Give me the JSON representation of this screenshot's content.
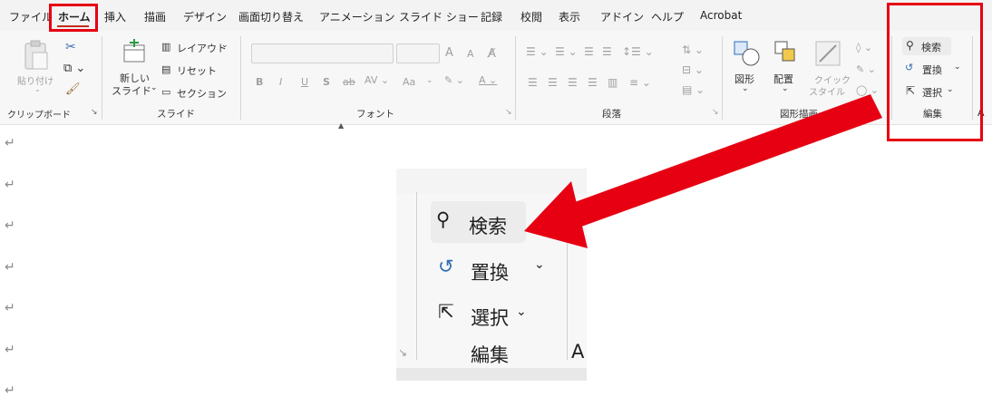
{
  "tabs": [
    "ファイル",
    "ホーム",
    "挿入",
    "描画",
    "デザイン",
    "画面切り替え",
    "アニメーション",
    "スライド ショー",
    "記録",
    "校閲",
    "表示",
    "アドイン",
    "ヘルプ",
    "Acrobat"
  ],
  "clipboard": {
    "paste": "貼り付け",
    "label": "クリップボード"
  },
  "slides": {
    "new_slide_line1": "新しい",
    "new_slide_line2": "スライド",
    "layout": "レイアウト",
    "reset": "リセット",
    "section": "セクション",
    "label": "スライド"
  },
  "font": {
    "label": "フォント",
    "bold": "B",
    "italic": "I",
    "underline": "U",
    "strike": "S",
    "aa": "Aa",
    "grow": "A",
    "shrink": "A"
  },
  "paragraph": {
    "label": "段落"
  },
  "drawing": {
    "shapes": "図形",
    "arrange": "配置",
    "quick_style_line1": "クイック",
    "quick_style_line2": "スタイル",
    "label": "図形描画"
  },
  "editing": {
    "find": "検索",
    "replace": "置換",
    "select": "選択",
    "label": "編集"
  },
  "paragraph_mark": "↵",
  "colors": {
    "highlight": "#e60012",
    "accent": "#c42b1c"
  }
}
